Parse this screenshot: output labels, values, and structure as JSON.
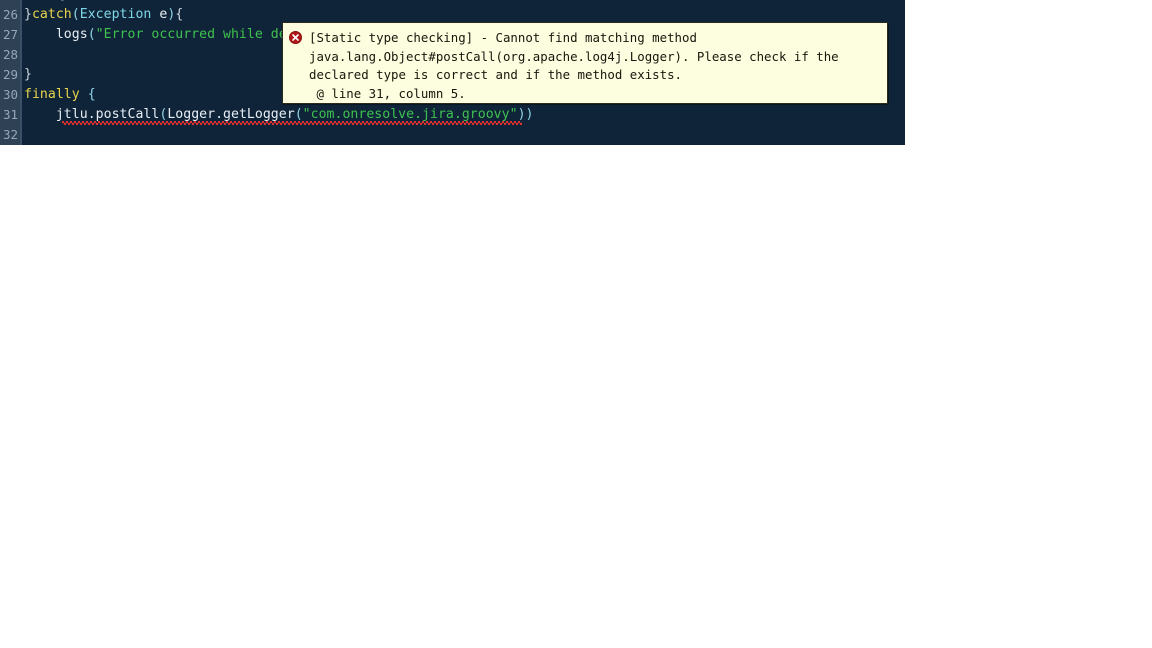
{
  "editor": {
    "background_color": "#0f2438",
    "gutter_color": "#2e4155",
    "gutter_line_number_color": "#93a7bd",
    "line_numbers": [
      "26",
      "27",
      "28",
      "29",
      "30",
      "31",
      "32"
    ],
    "lines": [
      {
        "number": "26",
        "tokens": [
          {
            "text": "}",
            "kind": "brace"
          },
          {
            "text": "catch",
            "kind": "keyword"
          },
          {
            "text": "(",
            "kind": "punct"
          },
          {
            "text": "Exception",
            "kind": "type"
          },
          {
            "text": " e",
            "kind": "ident"
          },
          {
            "text": ")",
            "kind": "punct"
          },
          {
            "text": "{",
            "kind": "brace"
          }
        ]
      },
      {
        "number": "27",
        "tokens": [
          {
            "text": "    ",
            "kind": "plain"
          },
          {
            "text": "logs",
            "kind": "ident"
          },
          {
            "text": "(",
            "kind": "punct"
          },
          {
            "text": "\"Error occurred while de",
            "kind": "string"
          }
        ]
      },
      {
        "number": "28",
        "tokens": []
      },
      {
        "number": "29",
        "tokens": [
          {
            "text": "}",
            "kind": "brace"
          }
        ]
      },
      {
        "number": "30",
        "tokens": [
          {
            "text": "finally",
            "kind": "keyword"
          },
          {
            "text": " ",
            "kind": "plain"
          },
          {
            "text": "{",
            "kind": "punct"
          }
        ]
      },
      {
        "number": "31",
        "tokens": [
          {
            "text": "    ",
            "kind": "plain"
          },
          {
            "text": "jtlu",
            "kind": "ident"
          },
          {
            "text": ".",
            "kind": "plain"
          },
          {
            "text": "postCall",
            "kind": "ident"
          },
          {
            "text": "(",
            "kind": "punct"
          },
          {
            "text": "Logger",
            "kind": "ident"
          },
          {
            "text": ".",
            "kind": "plain"
          },
          {
            "text": "getLogger",
            "kind": "ident"
          },
          {
            "text": "(",
            "kind": "punct"
          },
          {
            "text": "\"com.onresolve.jira.groovy\"",
            "kind": "string"
          },
          {
            "text": "))",
            "kind": "punct"
          }
        ],
        "has_error_underline": true
      },
      {
        "number": "32",
        "tokens": []
      }
    ],
    "partial_top_line_text": "}",
    "partial_bottom_line_text": "}"
  },
  "error_tooltip": {
    "icon": "error-circle-x-icon",
    "icon_color": "#b01818",
    "background_color": "#fdfddf",
    "border_color": "#2b2b1c",
    "lines": [
      "[Static type checking] - Cannot find matching method",
      "java.lang.Object#postCall(org.apache.log4j.Logger). Please check if the",
      "declared type is correct and if the method exists.",
      " @ line 31, column 5."
    ]
  }
}
